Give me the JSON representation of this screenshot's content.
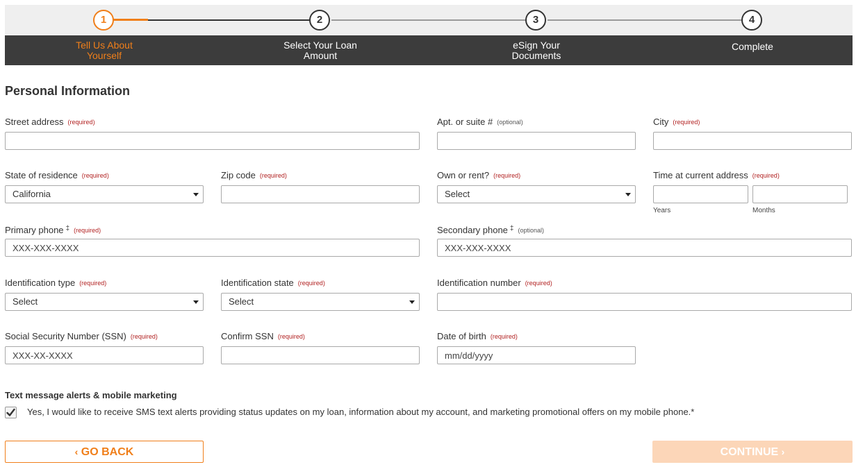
{
  "stepper": {
    "steps": [
      {
        "number": "1",
        "label": "Tell Us About\nYourself"
      },
      {
        "number": "2",
        "label": "Select Your Loan\nAmount"
      },
      {
        "number": "3",
        "label": "eSign Your\nDocuments"
      },
      {
        "number": "4",
        "label": "Complete"
      }
    ],
    "current_step": 1,
    "accent_color": "#f07f1a"
  },
  "form": {
    "title": "Personal Information",
    "required_text": "(required)",
    "optional_text": "(optional)",
    "fields": {
      "street_address": {
        "label": "Street address",
        "value": ""
      },
      "apt_suite": {
        "label": "Apt. or suite #",
        "value": ""
      },
      "city": {
        "label": "City",
        "value": ""
      },
      "state_of_residence": {
        "label": "State of residence",
        "value": "California"
      },
      "zip_code": {
        "label": "Zip code",
        "value": ""
      },
      "own_or_rent": {
        "label": "Own or rent?",
        "value": "Select"
      },
      "time_at_address": {
        "label": "Time at current address",
        "years_label": "Years",
        "months_label": "Months"
      },
      "primary_phone": {
        "label": "Primary phone",
        "marker": "‡",
        "placeholder": "XXX-XXX-XXXX"
      },
      "secondary_phone": {
        "label": "Secondary phone",
        "marker": "‡",
        "placeholder": "XXX-XXX-XXXX"
      },
      "identification_type": {
        "label": "Identification type",
        "value": "Select"
      },
      "identification_state": {
        "label": "Identification state",
        "value": "Select"
      },
      "identification_number": {
        "label": "Identification number",
        "value": ""
      },
      "ssn": {
        "label": "Social Security Number (SSN)",
        "placeholder": "XXX-XX-XXXX"
      },
      "confirm_ssn": {
        "label": "Confirm SSN",
        "value": ""
      },
      "date_of_birth": {
        "label": "Date of birth",
        "placeholder": "mm/dd/yyyy"
      }
    }
  },
  "sms": {
    "title": "Text message alerts & mobile marketing",
    "consent_text": "Yes, I would like to receive SMS text alerts providing status updates on my loan, information about my account, and marketing promotional offers on my mobile phone.*",
    "checked": true
  },
  "buttons": {
    "back_label": "GO BACK",
    "back_chevron": "‹",
    "continue_label": "CONTINUE",
    "continue_chevron": "›"
  }
}
